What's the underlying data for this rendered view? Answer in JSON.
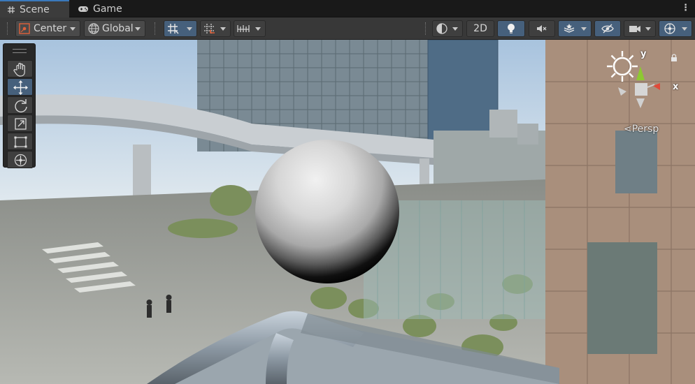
{
  "tabs": [
    {
      "label": "Scene",
      "icon": "grid-hash-icon",
      "active": true
    },
    {
      "label": "Game",
      "icon": "gamepad-icon",
      "active": false
    }
  ],
  "toolbar": {
    "pivot_label": "Center",
    "rotation_label": "Global",
    "mode_2d_label": "2D"
  },
  "gizmo": {
    "y_label": "y",
    "x_label": "x",
    "projection_label": "Persp"
  },
  "colors": {
    "accent": "#46607c",
    "tab_highlight": "#3a79bb",
    "gizmo_y": "#8ec832",
    "gizmo_x": "#e04a3a"
  }
}
